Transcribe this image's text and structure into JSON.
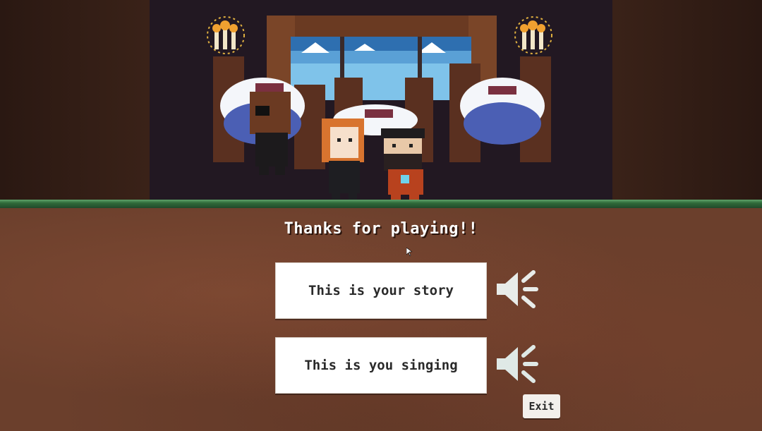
{
  "scene": {
    "description_icons": [
      "window-icon",
      "table-icon",
      "chair-icon",
      "candelabra-icon",
      "eyepatch-character-icon",
      "redhead-character-icon",
      "bearded-character-icon"
    ]
  },
  "end_screen": {
    "title": "Thanks for playing!!",
    "buttons": [
      {
        "label": "This is your story",
        "icon": "speaker-icon"
      },
      {
        "label": "This is you singing",
        "icon": "speaker-icon"
      }
    ],
    "exit_label": "Exit"
  },
  "colors": {
    "ground": "#6b3f2c",
    "grass": "#2f6a3a",
    "button_bg": "#ffffff",
    "button_text": "#2a2a2a",
    "speaker": "#e8ece9"
  }
}
